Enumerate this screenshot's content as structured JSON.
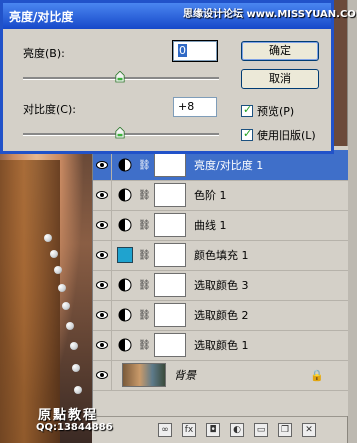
{
  "dialog": {
    "title": "亮度/对比度",
    "brightness_label": "亮度(B):",
    "brightness_value": "0",
    "contrast_label": "对比度(C):",
    "contrast_value": "+8",
    "brightness_level": 0.5,
    "contrast_level": 0.5,
    "ok_label": "确定",
    "cancel_label": "取消",
    "preview_label": "预览(P)",
    "preview_checked": true,
    "legacy_label": "使用旧版(L)",
    "legacy_checked": true
  },
  "layers": [
    {
      "name": "亮度/对比度 1",
      "type": "adjustment",
      "selected": true
    },
    {
      "name": "色阶 1",
      "type": "adjustment",
      "selected": false
    },
    {
      "name": "曲线 1",
      "type": "adjustment",
      "selected": false
    },
    {
      "name": "颜色填充 1",
      "type": "fill",
      "color": "#1fa3cf",
      "selected": false
    },
    {
      "name": "选取颜色 3",
      "type": "adjustment",
      "selected": false
    },
    {
      "name": "选取颜色 2",
      "type": "adjustment",
      "selected": false
    },
    {
      "name": "选取颜色 1",
      "type": "adjustment",
      "selected": false
    },
    {
      "name": "背景",
      "type": "background",
      "locked": true,
      "selected": false
    }
  ],
  "bottom_bar": {
    "icons": [
      "link-icon",
      "fx-icon",
      "mask-icon",
      "adjustment-icon",
      "folder-icon",
      "new-layer-icon",
      "trash-icon"
    ],
    "fx_label": "fx"
  },
  "watermark": {
    "top": "思缘设计论坛 www.MISSYUAN.COM",
    "bottom_title": "原點教程",
    "bottom_qq": "QQ:13844886"
  },
  "colors": {
    "titlebar": "#1648c9",
    "selected_row": "#3f6fc9",
    "panel_bg": "#d4d0c8"
  }
}
